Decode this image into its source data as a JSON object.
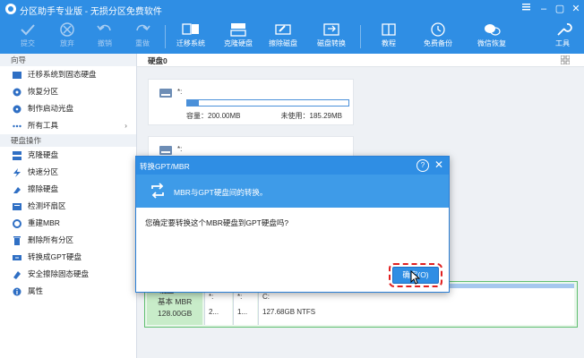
{
  "app": {
    "title": "分区助手专业版 - 无损分区免费软件"
  },
  "window_controls": {
    "minimize": "–",
    "restore": "▢",
    "close": "✕"
  },
  "toolbar": {
    "buttons": [
      {
        "label": "提交",
        "icon": "check-icon",
        "enabled": false
      },
      {
        "label": "放弃",
        "icon": "discard-icon",
        "enabled": false
      },
      {
        "label": "撤销",
        "icon": "undo-icon",
        "enabled": false
      },
      {
        "label": "重做",
        "icon": "redo-icon",
        "enabled": false
      },
      {
        "label": "迁移系统",
        "icon": "migrate-os-icon",
        "enabled": true
      },
      {
        "label": "克隆硬盘",
        "icon": "clone-disk-icon",
        "enabled": true
      },
      {
        "label": "擦除磁盘",
        "icon": "wipe-disk-icon",
        "enabled": true
      },
      {
        "label": "磁盘转换",
        "icon": "disk-convert-icon",
        "enabled": true
      },
      {
        "label": "教程",
        "icon": "tutorial-icon",
        "enabled": true
      },
      {
        "label": "免费备份",
        "icon": "backup-icon",
        "enabled": true
      },
      {
        "label": "微信恢复",
        "icon": "wechat-recovery-icon",
        "enabled": true
      },
      {
        "label": "工具",
        "icon": "wrench-icon",
        "enabled": true
      }
    ]
  },
  "sidebar": {
    "wizard_title": "向导",
    "wizard_items": [
      {
        "label": "迁移系统到固态硬盘",
        "icon": "migrate-icon"
      },
      {
        "label": "恢复分区",
        "icon": "recover-icon"
      },
      {
        "label": "制作启动光盘",
        "icon": "bootable-icon"
      },
      {
        "label": "所有工具",
        "icon": "more-icon",
        "chevron": "›"
      }
    ],
    "disk_ops_title": "硬盘操作",
    "disk_ops_items": [
      {
        "label": "克隆硬盘",
        "icon": "clone-icon"
      },
      {
        "label": "快速分区",
        "icon": "lightning-icon"
      },
      {
        "label": "擦除硬盘",
        "icon": "wipe-icon"
      },
      {
        "label": "检测坏扇区",
        "icon": "scan-icon"
      },
      {
        "label": "重建MBR",
        "icon": "rebuild-icon"
      },
      {
        "label": "删除所有分区",
        "icon": "delete-icon"
      },
      {
        "label": "转换成GPT硬盘",
        "icon": "convert-icon"
      },
      {
        "label": "安全擦除固态硬盘",
        "icon": "ssd-erase-icon"
      },
      {
        "label": "属性",
        "icon": "info-icon"
      }
    ]
  },
  "main": {
    "disk_label": "硬盘0",
    "partition_card": {
      "name": "*:",
      "capacity": "容量：200.00MB",
      "used": "未使用：185.29MB",
      "used_fraction": 0.07
    },
    "partition_card2": {
      "name": "*:"
    }
  },
  "disk_map": {
    "disk_name": "硬盘0",
    "disk_type": "基本 MBR",
    "disk_size": "128.00GB",
    "partitions": [
      {
        "name": "*:",
        "size": "2..."
      },
      {
        "name": "*:",
        "size": "1..."
      },
      {
        "name": "C:",
        "size": "127.68GB NTFS"
      }
    ]
  },
  "dialog": {
    "title": "转换GPT/MBR",
    "help": "?",
    "close": "✕",
    "banner": "MBR与GPT硬盘间的转换。",
    "question": "您确定要转换这个MBR硬盘到GPT硬盘吗?",
    "ok_label": "确定(O)"
  },
  "colors": {
    "accent": "#2f8ee4",
    "disk_green": "#5fbf6f",
    "highlight": "#e02020"
  }
}
